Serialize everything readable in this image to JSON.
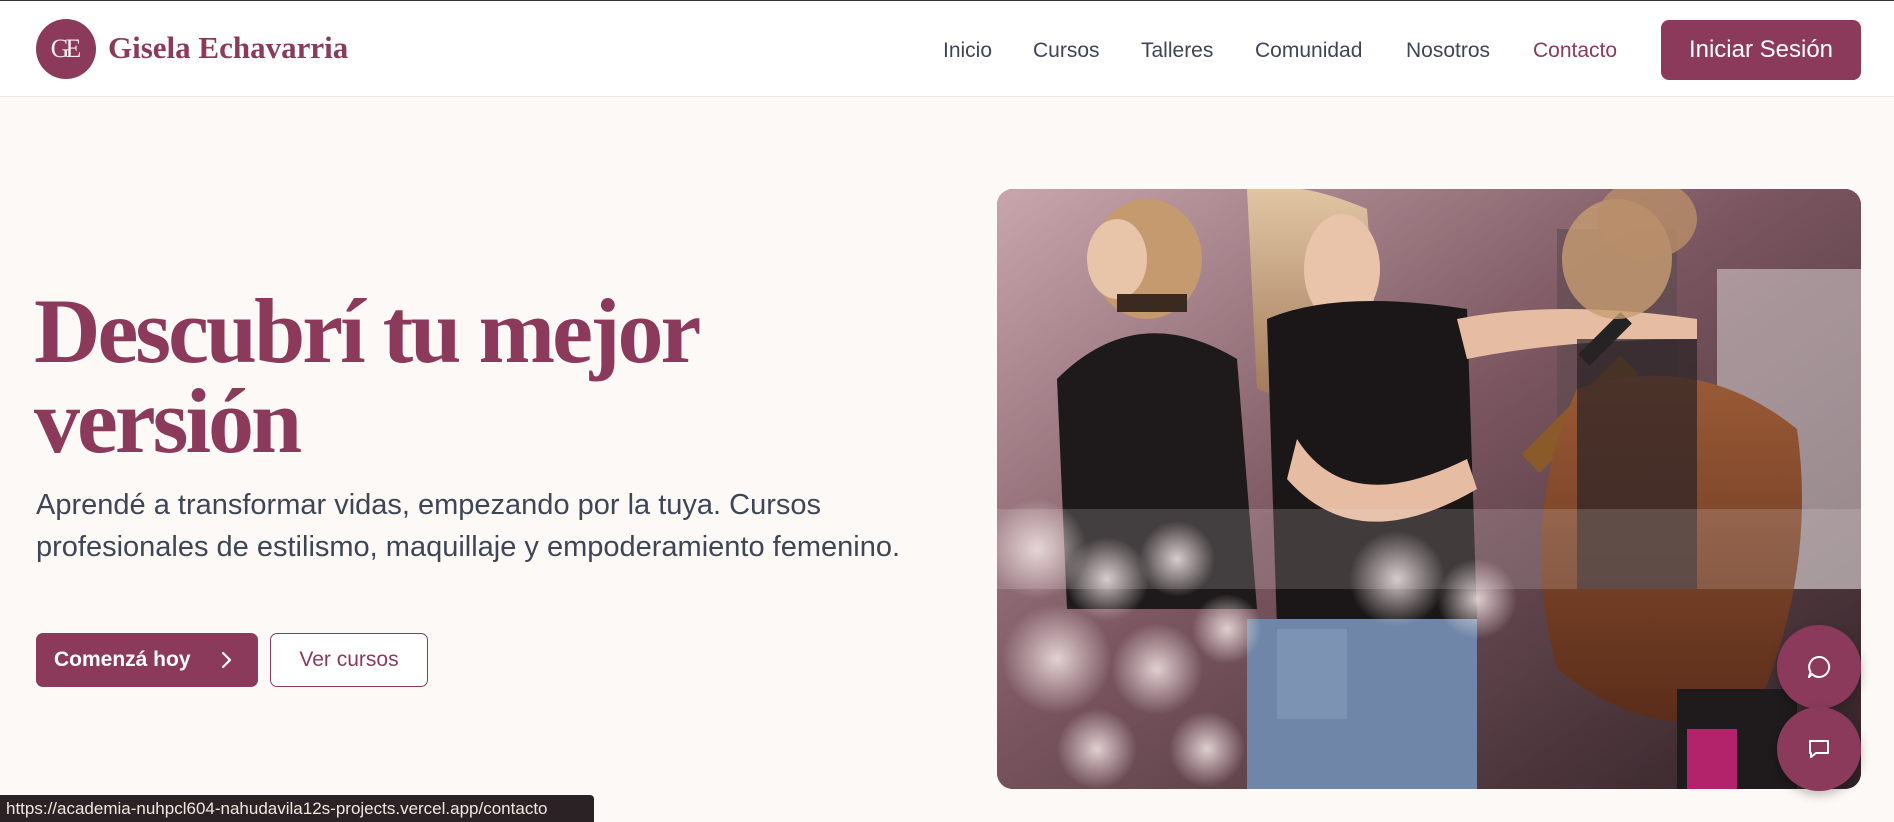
{
  "brand": {
    "logo_initials": "GE",
    "name": "Gisela Echavarria"
  },
  "nav": {
    "items": [
      {
        "label": "Inicio"
      },
      {
        "label": "Cursos"
      },
      {
        "label": "Talleres"
      },
      {
        "label": "Comunidad"
      },
      {
        "label": "Nosotros"
      },
      {
        "label": "Contacto",
        "active": true
      }
    ],
    "login_label": "Iniciar Sesión"
  },
  "hero": {
    "title": "Descubrí tu mejor versión",
    "subtitle": "Aprendé a transformar vidas, empezando por la tuya. Cursos profesionales de estilismo, maquillaje y empoderamiento femenino.",
    "primary_cta": "Comenzá hoy",
    "secondary_cta": "Ver cursos",
    "image_description_icon": "hairstylist-photo"
  },
  "floating_buttons": [
    {
      "icon": "chat-bubble-round-icon"
    },
    {
      "icon": "chat-bubble-square-icon"
    }
  ],
  "status_bar": {
    "url": "https://academia-nuhpcl604-nahudavila12s-projects.vercel.app/contacto"
  },
  "colors": {
    "brand": "#8b3a5c",
    "text": "#3e4656",
    "background": "#fdf9f6"
  }
}
